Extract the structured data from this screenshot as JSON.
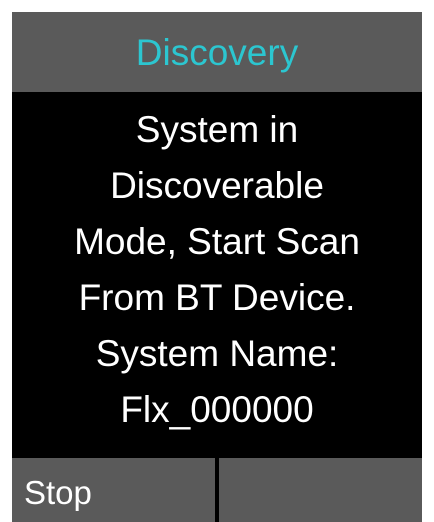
{
  "header": {
    "title": "Discovery"
  },
  "message": {
    "lines": [
      "System in",
      "Discoverable",
      "Mode, Start Scan",
      "From BT Device.",
      "System Name:",
      "Flx_000000"
    ]
  },
  "softkeys": {
    "left_label": "Stop",
    "right_label": ""
  },
  "colors": {
    "title_text": "#2cc6d0",
    "bar_background": "#5a5a5a",
    "screen_background": "#000000",
    "body_text": "#ffffff"
  }
}
